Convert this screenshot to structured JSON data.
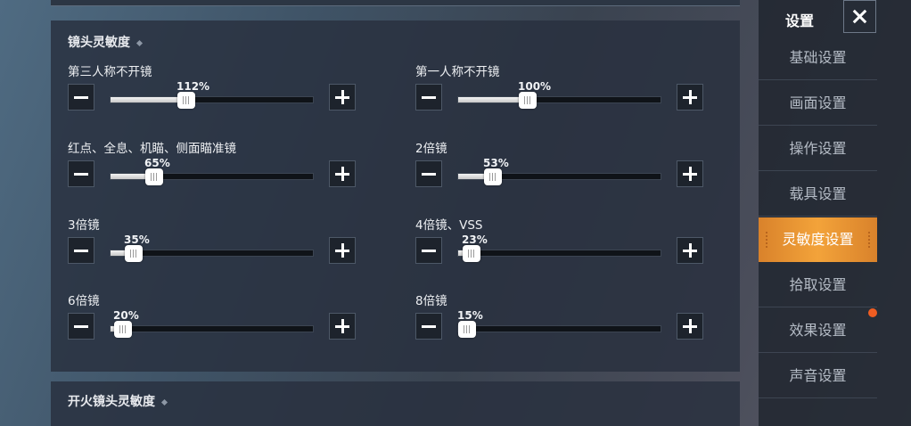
{
  "main_section": {
    "title": "镜头灵敏度"
  },
  "fire_section": {
    "title": "开火镜头灵敏度"
  },
  "sliders": [
    {
      "label": "第三人称不开镜",
      "value_text": "112%",
      "fraction": 0.37
    },
    {
      "label": "第一人称不开镜",
      "value_text": "100%",
      "fraction": 0.34
    },
    {
      "label": "红点、全息、机瞄、侧面瞄准镜",
      "value_text": "65%",
      "fraction": 0.215
    },
    {
      "label": "2倍镜",
      "value_text": "53%",
      "fraction": 0.17
    },
    {
      "label": "3倍镜",
      "value_text": "35%",
      "fraction": 0.115
    },
    {
      "label": "4倍镜、VSS",
      "value_text": "23%",
      "fraction": 0.065
    },
    {
      "label": "6倍镜",
      "value_text": "20%",
      "fraction": 0.06
    },
    {
      "label": "8倍镜",
      "value_text": "15%",
      "fraction": 0.045
    }
  ],
  "sidebar": {
    "title": "设置",
    "items": [
      {
        "label": "基础设置"
      },
      {
        "label": "画面设置"
      },
      {
        "label": "操作设置"
      },
      {
        "label": "载具设置"
      },
      {
        "label": "灵敏度设置",
        "active": true
      },
      {
        "label": "拾取设置"
      },
      {
        "label": "效果设置",
        "notification_dot": true
      },
      {
        "label": "声音设置"
      }
    ]
  },
  "icons": {
    "minus": "minus-icon",
    "plus": "plus-icon",
    "close": "close-icon"
  },
  "colors": {
    "active_tab": "#f3a33a",
    "notification_dot": "#ef5d22",
    "panel_bg": "#283040"
  }
}
